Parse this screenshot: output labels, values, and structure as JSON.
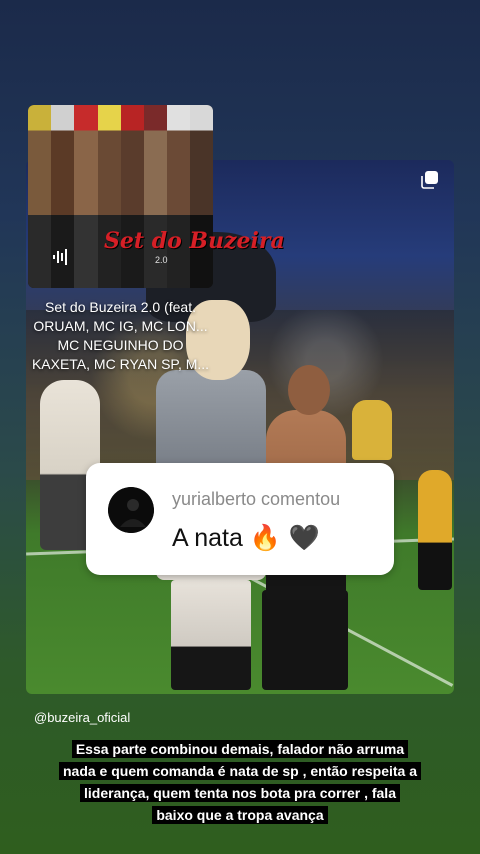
{
  "album": {
    "title": "Set do Buzeira",
    "subtitle": "2.0"
  },
  "song": {
    "title": "Set do Buzeira 2.0 (feat.",
    "artists": "ORUAM, MC IG, MC LON...",
    "artists_2": "MC NEGUINHO DO",
    "artists_3": "KAXETA, MC RYAN SP, M..."
  },
  "comment": {
    "username": "yurialberto comentou",
    "text": "A nata",
    "emoji": "🔥 🖤"
  },
  "mention": "@buzeira_oficial",
  "caption": {
    "line1": "Essa parte combinou demais, falador não arruma",
    "line2": "nada e quem comanda é nata de sp , então respeita a",
    "line3": "liderança, quem tenta nos bota pra correr , fala",
    "line4": "baixo que a tropa avança"
  },
  "colors": {
    "album_title_red": "#d61f26",
    "caption_bg": "#000000",
    "comment_bg": "#ffffff",
    "comment_user": "#8a8a8a"
  },
  "icons": {
    "copy": "copy-icon",
    "audio": "audio-wave-icon"
  }
}
